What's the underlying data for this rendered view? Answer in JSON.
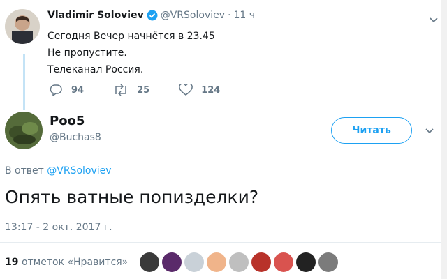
{
  "original_tweet": {
    "author_name": "Vladimir Soloviev",
    "handle": "@VRSoloviev",
    "age": "11 ч",
    "lines": [
      "Сегодня Вечер начнётся в 23.45",
      "Не пропустите.",
      "Телеканал Россия."
    ],
    "replies": "94",
    "retweets": "25",
    "likes": "124"
  },
  "reply_tweet": {
    "author_name": "Poo5",
    "handle": "@Buchas8",
    "follow_label": "Читать",
    "reply_prefix": "В ответ",
    "reply_to": "@VRSoloviev",
    "text": "Опять ватные попизделки?",
    "timestamp": "13:17 - 2 окт. 2017 г.",
    "likes_count": "19",
    "likes_label": "отметок «Нравится»"
  },
  "colors": {
    "accent": "#1da1f2",
    "muted": "#657786",
    "thread_line": "#c4e3f6"
  }
}
